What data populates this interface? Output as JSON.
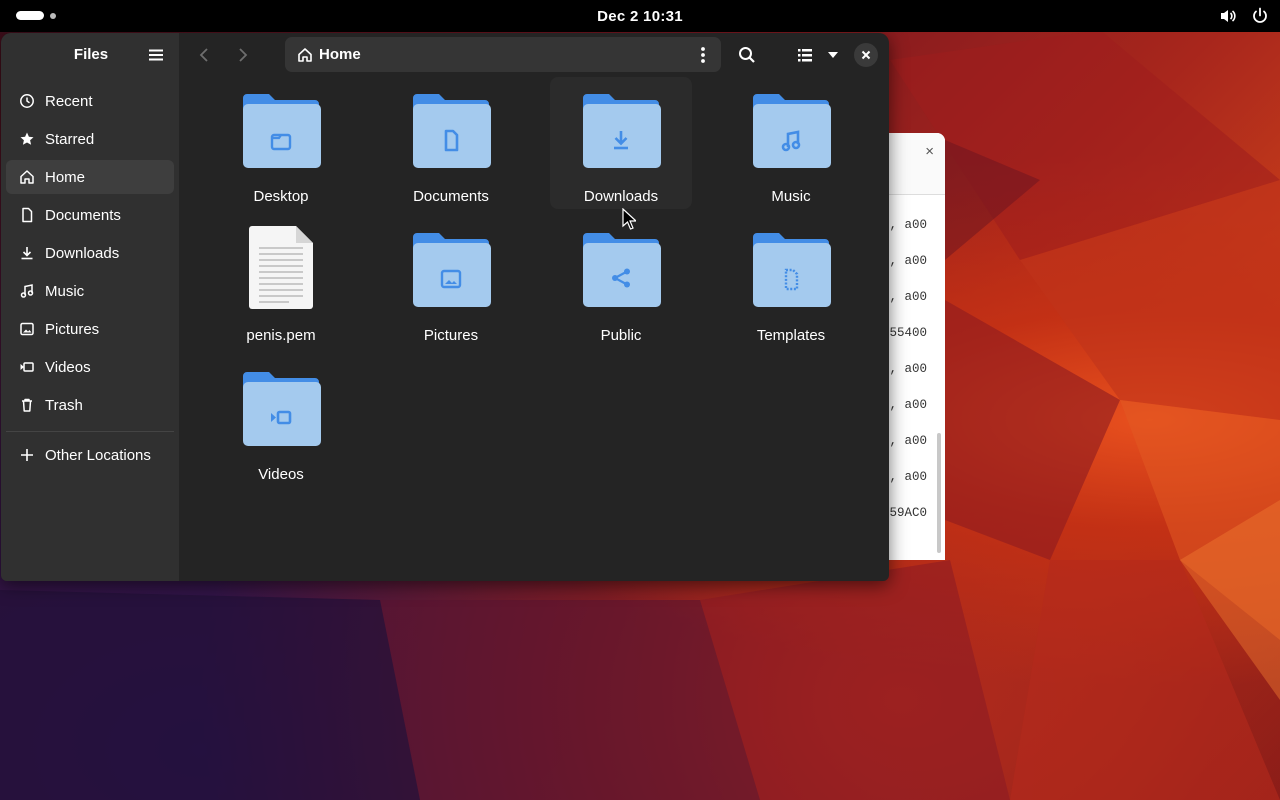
{
  "topbar": {
    "clock": "Dec 2  10:31",
    "tray_icons": [
      "volume-icon",
      "power-icon"
    ]
  },
  "background_window": {
    "close_glyph": "×",
    "lines": [
      ", a00",
      ", a00",
      ", a00",
      "55400",
      ", a00",
      ", a00",
      ", a00",
      ", a00",
      "59AC0"
    ]
  },
  "files": {
    "sidebar": {
      "title": "Files",
      "items": [
        {
          "label": "Recent",
          "icon": "clock-icon"
        },
        {
          "label": "Starred",
          "icon": "star-icon"
        },
        {
          "label": "Home",
          "icon": "home-icon",
          "active": true
        },
        {
          "label": "Documents",
          "icon": "document-icon"
        },
        {
          "label": "Downloads",
          "icon": "download-icon"
        },
        {
          "label": "Music",
          "icon": "music-icon"
        },
        {
          "label": "Pictures",
          "icon": "picture-icon"
        },
        {
          "label": "Videos",
          "icon": "video-icon"
        },
        {
          "label": "Trash",
          "icon": "trash-icon"
        }
      ],
      "other_locations": "Other Locations"
    },
    "toolbar": {
      "path_label": "Home"
    },
    "items": [
      {
        "label": "Desktop",
        "kind": "folder",
        "emblem": "folder-icon"
      },
      {
        "label": "Documents",
        "kind": "folder",
        "emblem": "document-icon"
      },
      {
        "label": "Downloads",
        "kind": "folder",
        "emblem": "download-icon",
        "hover": true
      },
      {
        "label": "Music",
        "kind": "folder",
        "emblem": "music-icon"
      },
      {
        "label": "penis.pem",
        "kind": "file",
        "emblem": "text-file-icon"
      },
      {
        "label": "Pictures",
        "kind": "folder",
        "emblem": "picture-icon"
      },
      {
        "label": "Public",
        "kind": "folder",
        "emblem": "share-icon"
      },
      {
        "label": "Templates",
        "kind": "folder",
        "emblem": "template-icon"
      },
      {
        "label": "Videos",
        "kind": "folder",
        "emblem": "video-icon"
      }
    ]
  },
  "colors": {
    "window_bg": "#242424",
    "sidebar_bg": "#303030",
    "folder_back": "#438de6",
    "folder_front": "#a4caee",
    "folder_emblem": "#438de6"
  }
}
